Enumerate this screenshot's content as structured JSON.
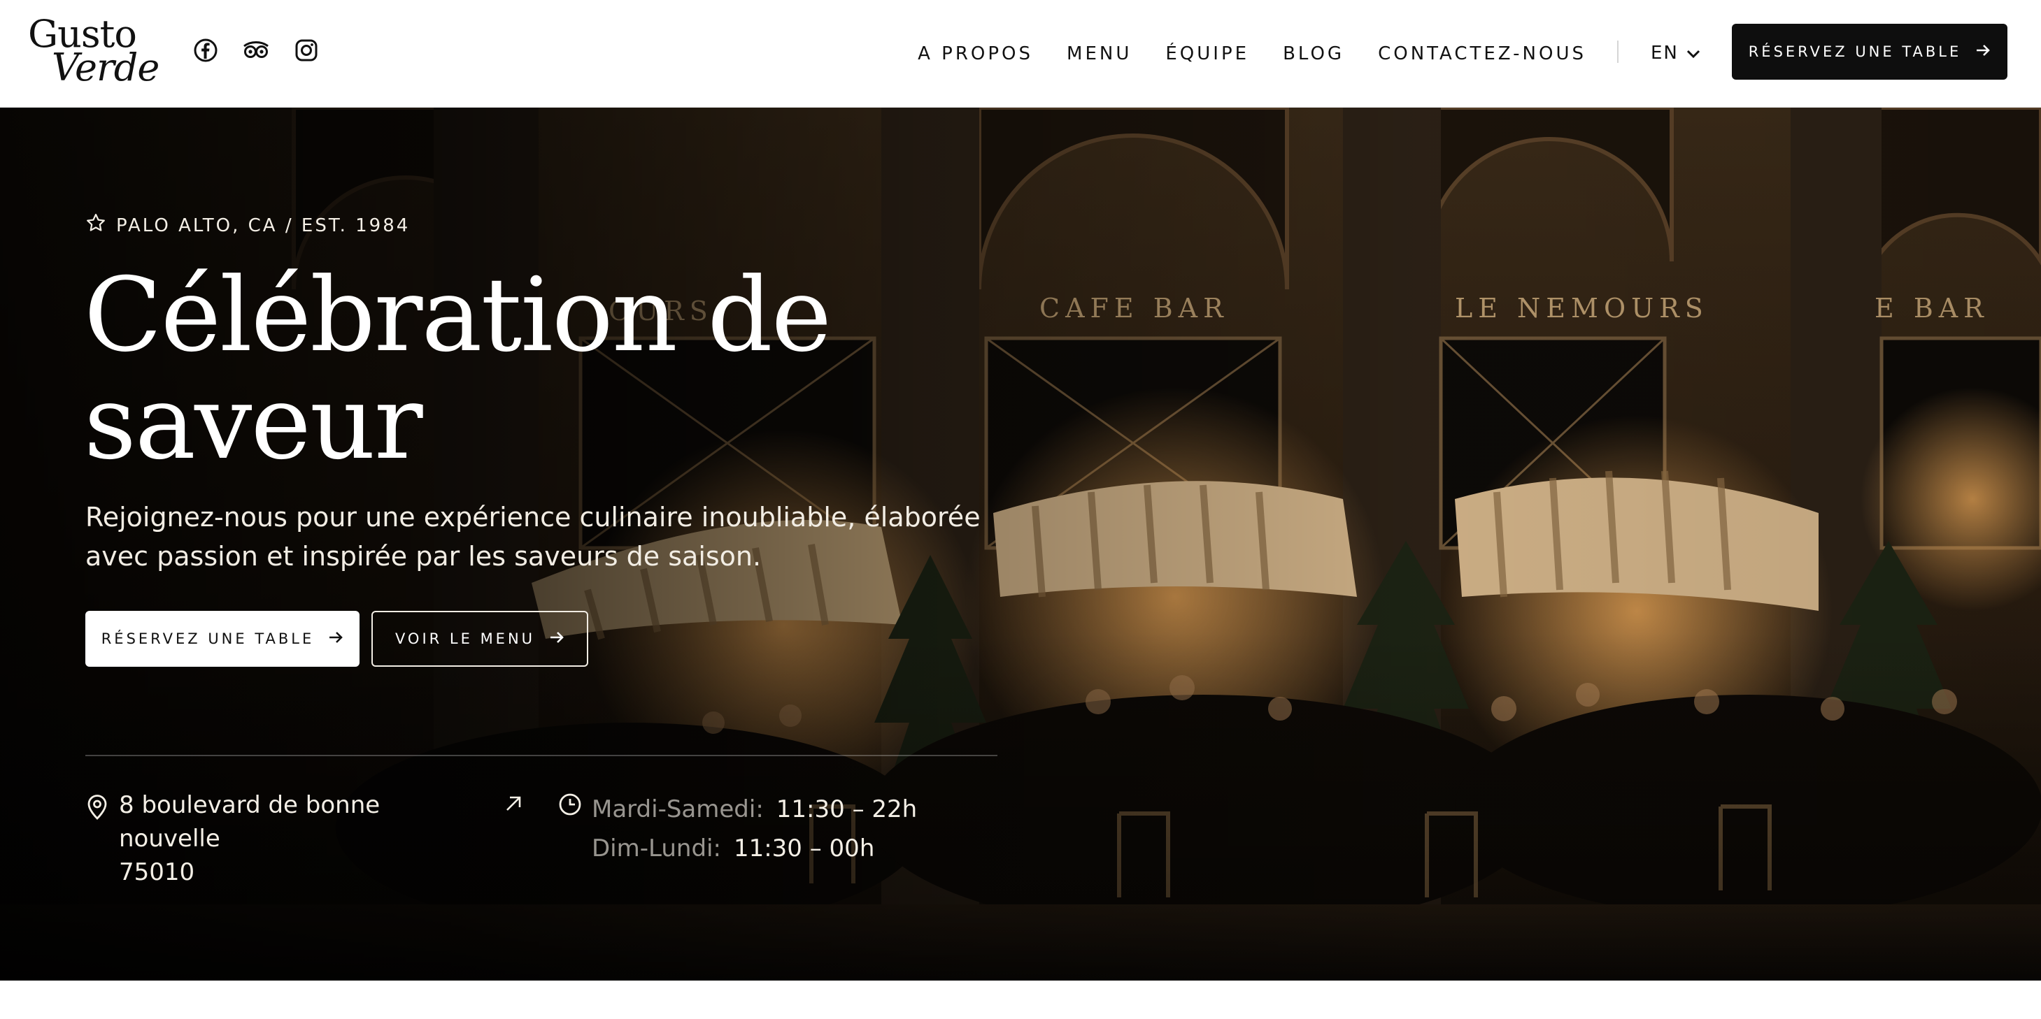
{
  "brand": {
    "line1": "Gusto",
    "line2": "Verde"
  },
  "socials": [
    {
      "icon": "facebook-icon"
    },
    {
      "icon": "tripadvisor-icon"
    },
    {
      "icon": "instagram-icon"
    }
  ],
  "nav": {
    "items": [
      "A PROPOS",
      "MENU",
      "ÉQUIPE",
      "BLOG",
      "CONTACTEZ-NOUS"
    ],
    "language": "EN",
    "cta_label": "RÉSERVEZ UNE TABLE"
  },
  "hero": {
    "eyebrow": "PALO ALTO, CA / EST. 1984",
    "title_line1": "Célébration de",
    "title_line2": "saveur",
    "subtitle": "Rejoignez-nous pour une expérience culinaire inoubliable, élaborée avec passion et inspirée par les saveurs de saison.",
    "primary_button": "RÉSERVEZ UNE TABLE",
    "secondary_button": "VOIR LE MENU",
    "address_line1": "8 boulevard de bonne nouvelle",
    "address_line2": "75010",
    "hours": [
      {
        "days": "Mardi-Samedi:",
        "time": "11:30 – 22h"
      },
      {
        "days": "Dim-Lundi:",
        "time": "11:30 – 00h"
      }
    ]
  },
  "colors": {
    "dark": "#0e0e0e",
    "cream": "#f4efe6",
    "accent_warm": "#c58b48"
  }
}
